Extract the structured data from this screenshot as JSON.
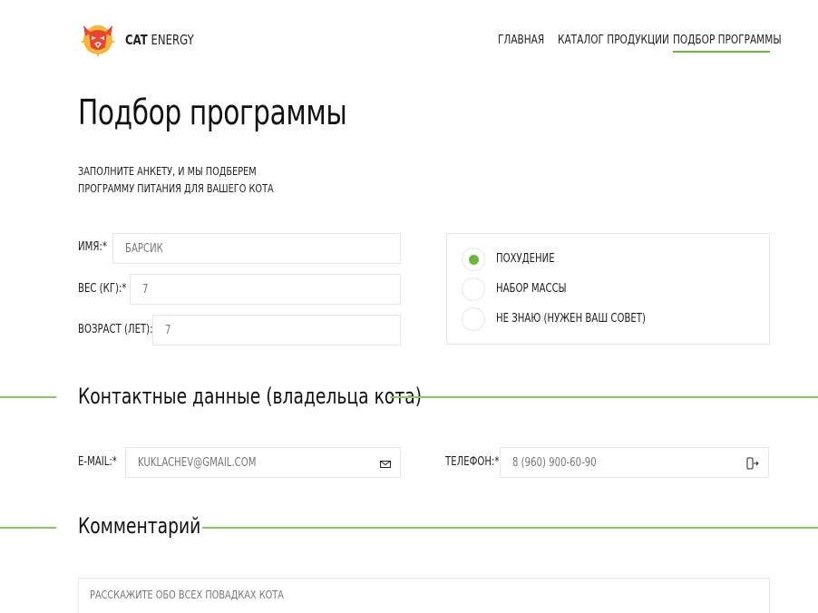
{
  "header": {
    "logo_bold": "CAT",
    "logo_light": "ENERGY",
    "nav": [
      {
        "label": "ГЛАВНАЯ"
      },
      {
        "label": "КАТАЛОГ ПРОДУКЦИИ"
      },
      {
        "label": "ПОДБОР ПРОГРАММЫ"
      }
    ],
    "accent_color": "#68b738"
  },
  "page": {
    "title": "Подбор программы",
    "intro_line1": "ЗАПОЛНИТЕ АНКЕТУ, И МЫ ПОДБЕРЕМ",
    "intro_line2": "ПРОГРАММУ ПИТАНИЯ ДЛЯ ВАШЕГО КОТА"
  },
  "form": {
    "name_label": "ИМЯ:*",
    "name_placeholder": "БАРСИК",
    "weight_label": "ВЕС (КГ):*",
    "weight_value": "7",
    "age_label": "ВОЗРАСТ (ЛЕТ):",
    "age_value": "7",
    "goals": [
      {
        "label": "ПОХУДЕНИЕ",
        "selected": true
      },
      {
        "label": "НАБОР МАССЫ",
        "selected": false
      },
      {
        "label": "НЕ ЗНАЮ (НУЖЕН ВАШ СОВЕТ)",
        "selected": false
      }
    ]
  },
  "contacts": {
    "section_title": "Контактные данные (владельца кота)",
    "email_label": "E-MAIL:*",
    "email_placeholder": "KUKLACHEV@GMAIL.COM",
    "email_icon": "envelope-icon",
    "phone_label": "ТЕЛЕФОН:*",
    "phone_placeholder": "8 (960) 900-60-90",
    "phone_icon": "phone-icon"
  },
  "comment": {
    "section_title": "Комментарий",
    "placeholder": "РАССКАЖИТЕ ОБО ВСЕХ ПОВАДКАХ КОТА"
  }
}
